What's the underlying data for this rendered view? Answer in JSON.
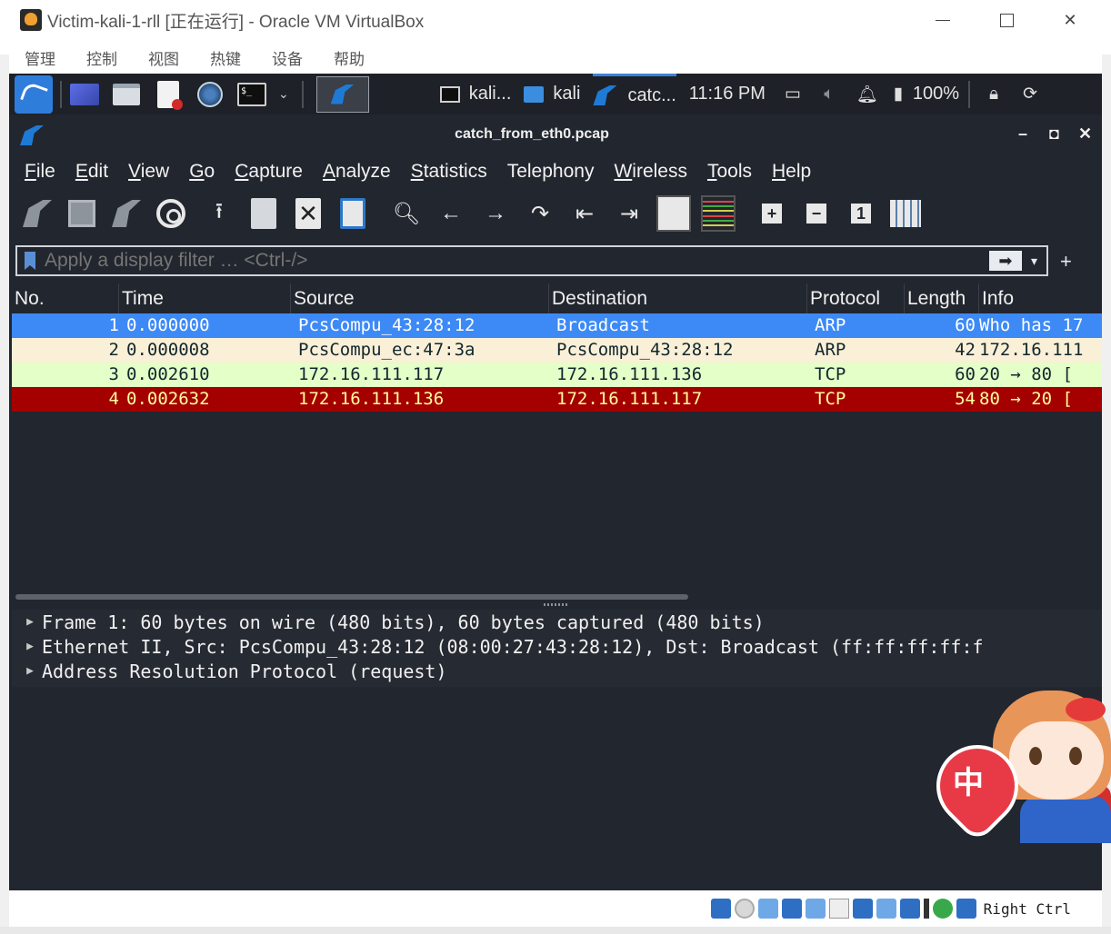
{
  "vbox": {
    "title": "Victim-kali-1-rll [正在运行] - Oracle VM VirtualBox",
    "menu": [
      "管理",
      "控制",
      "视图",
      "热键",
      "设备",
      "帮助"
    ],
    "status_right": "Right Ctrl"
  },
  "kali_panel": {
    "tasks": [
      {
        "label": "kali...",
        "icon": "terminal-icon"
      },
      {
        "label": "kali",
        "icon": "folder-icon"
      },
      {
        "label": "catc...",
        "icon": "wireshark-icon"
      }
    ],
    "clock": "11:16 PM",
    "battery": "100%"
  },
  "wireshark": {
    "title": "catch_from_eth0.pcap",
    "window_controls": {
      "minimize": "–",
      "maximize": "◘",
      "close": "✕"
    },
    "menu": [
      {
        "u": "F",
        "rest": "ile"
      },
      {
        "u": "E",
        "rest": "dit"
      },
      {
        "u": "V",
        "rest": "iew"
      },
      {
        "u": "G",
        "rest": "o"
      },
      {
        "u": "C",
        "rest": "apture"
      },
      {
        "u": "A",
        "rest": "nalyze"
      },
      {
        "u": "S",
        "rest": "tatistics"
      },
      {
        "u": "",
        "rest": "Telephony"
      },
      {
        "u": "W",
        "rest": "ireless"
      },
      {
        "u": "T",
        "rest": "ools"
      },
      {
        "u": "H",
        "rest": "elp"
      }
    ],
    "filter": {
      "placeholder": "Apply a display filter … <Ctrl-/>",
      "apply_symbol": "➡",
      "dropdown_symbol": "▾",
      "add_symbol": "+"
    },
    "columns": [
      "No.",
      "Time",
      "Source",
      "Destination",
      "Protocol",
      "Length",
      "Info"
    ],
    "packets": [
      {
        "no": "1",
        "time": "0.000000",
        "src": "PcsCompu_43:28:12",
        "dst": "Broadcast",
        "proto": "ARP",
        "len": "60",
        "info": "Who has 17",
        "bg": "#3d8af7",
        "fg": "#ffffff"
      },
      {
        "no": "2",
        "time": "0.000008",
        "src": "PcsCompu_ec:47:3a",
        "dst": "PcsCompu_43:28:12",
        "proto": "ARP",
        "len": "42",
        "info": "172.16.111",
        "bg": "#faf0d7",
        "fg": "#12272e"
      },
      {
        "no": "3",
        "time": "0.002610",
        "src": "172.16.111.117",
        "dst": "172.16.111.136",
        "proto": "TCP",
        "len": "60",
        "info": "20 → 80 [",
        "bg": "#e4ffc7",
        "fg": "#12272e"
      },
      {
        "no": "4",
        "time": "0.002632",
        "src": "172.16.111.136",
        "dst": "172.16.111.117",
        "proto": "TCP",
        "len": "54",
        "info": "80 → 20 [",
        "bg": "#a40000",
        "fg": "#fffc9c"
      }
    ],
    "details": [
      "Frame 1: 60 bytes on wire (480 bits), 60 bytes captured (480 bits)",
      "Ethernet II, Src: PcsCompu_43:28:12 (08:00:27:43:28:12), Dst: Broadcast (ff:ff:ff:ff:f",
      "Address Resolution Protocol (request)"
    ],
    "detail_arrow": "▶"
  },
  "mascot": {
    "heart_char": "中"
  }
}
